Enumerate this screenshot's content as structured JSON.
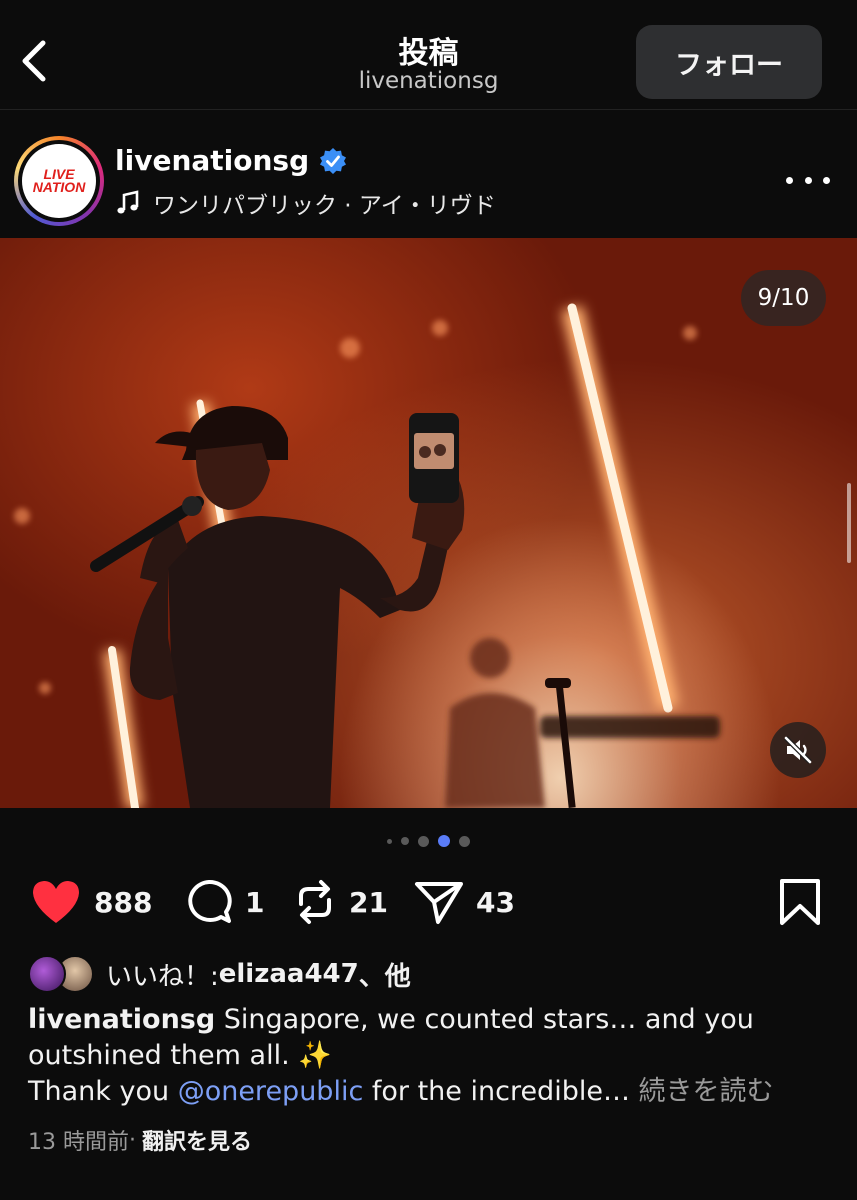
{
  "header": {
    "title": "投稿",
    "subtitle": "livenationsg",
    "follow_label": "フォロー"
  },
  "post": {
    "username": "livenationsg",
    "avatar_logo": "LIVE NATION",
    "music": "ワンリパブリック · アイ・リヴド",
    "photo_counter": "9/10",
    "icons": {
      "verified": "verified-badge-icon",
      "music": "music-note-icon",
      "more": "more-dots-icon",
      "mute": "speaker-muted-icon"
    },
    "carousel": {
      "current_index": 3,
      "dot_count": 5
    }
  },
  "actions": {
    "likes": "888",
    "comments": "1",
    "reposts": "21",
    "shares": "43"
  },
  "likes_row": {
    "prefix": "いいね！: ",
    "user": "elizaa447",
    "suffix": "、他"
  },
  "caption": {
    "user": "livenationsg",
    "line1": " Singapore, we counted stars… and you outshined them all. ✨",
    "line2_a": "Thank you ",
    "mention": "@onerepublic",
    "line2_b": " for the incredible…",
    "more_label": " 続きを読む"
  },
  "meta": {
    "time": "13 時間前",
    "separator": " · ",
    "translate": "翻訳を見る"
  },
  "colors": {
    "background": "#0c0c0c",
    "heart": "#ff3040",
    "mention": "#7d9ff5",
    "verified": "#3b8ff6",
    "active_dot": "#5a7cf7"
  }
}
